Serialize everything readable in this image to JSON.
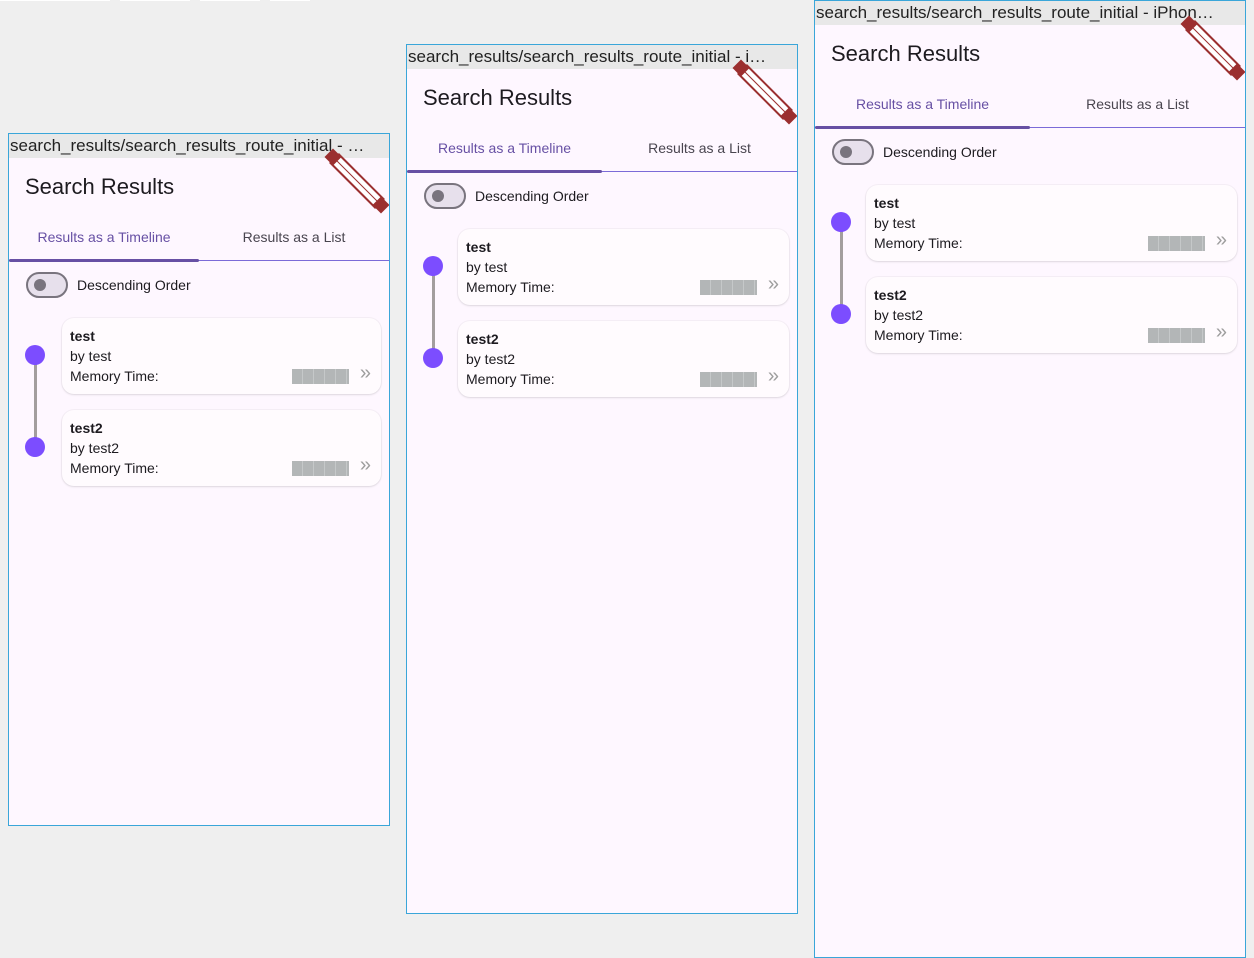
{
  "page": {
    "title": "Search Results",
    "tabs": [
      "Results as a Timeline",
      "Results as a List"
    ],
    "toggle_label": "Descending Order",
    "colors": {
      "accent": "#6750a4",
      "timeline_dot": "#7c4dff",
      "frame_border": "#3aa6d9",
      "background": "#fef7ff"
    },
    "results": [
      {
        "title": "test",
        "author": "by test",
        "memory_label": "Memory Time:",
        "icon": "double-chevron-right-icon"
      },
      {
        "title": "test2",
        "author": "by test2",
        "memory_label": "Memory Time:",
        "icon": "double-chevron-right-icon"
      }
    ]
  },
  "frames": [
    {
      "label": "search_results/search_results_route_initial - …"
    },
    {
      "label": "search_results/search_results_route_initial - i…"
    },
    {
      "label": "search_results/search_results_route_initial - iPhon…"
    }
  ],
  "toggle_state": "off"
}
